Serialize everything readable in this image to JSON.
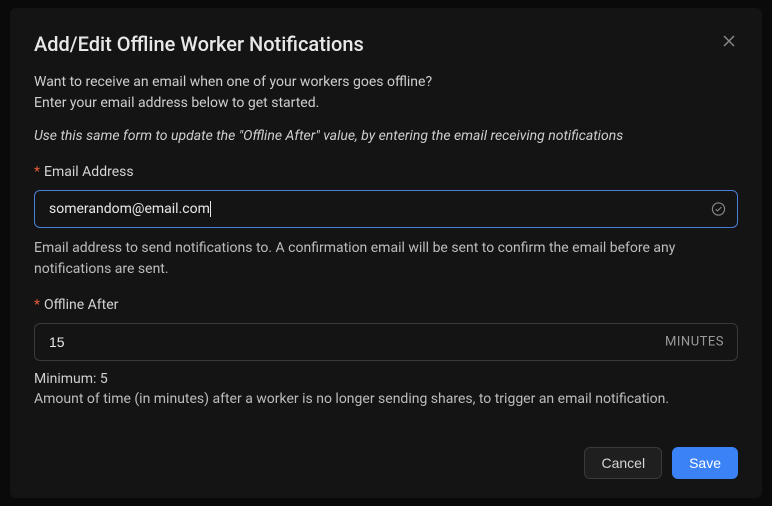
{
  "modal": {
    "title": "Add/Edit Offline Worker Notifications",
    "description_line1": "Want to receive an email when one of your workers goes offline?",
    "description_line2": "Enter your email address below to get started.",
    "description_italic": "Use this same form to update the \"Offline After\" value, by entering the email receiving notifications"
  },
  "email": {
    "label": "Email Address",
    "value": "somerandom@email.com",
    "help": "Email address to send notifications to. A confirmation email will be sent to confirm the email before any notifications are sent.",
    "status_icon": "check-circle-icon"
  },
  "offline_after": {
    "label": "Offline After",
    "value": "15",
    "unit": "MINUTES",
    "minimum_label": "Minimum: 5",
    "help": "Amount of time (in minutes) after a worker is no longer sending shares, to trigger an email notification."
  },
  "buttons": {
    "cancel": "Cancel",
    "save": "Save"
  },
  "colors": {
    "accent": "#3b82f6",
    "required": "#e05a3a"
  }
}
